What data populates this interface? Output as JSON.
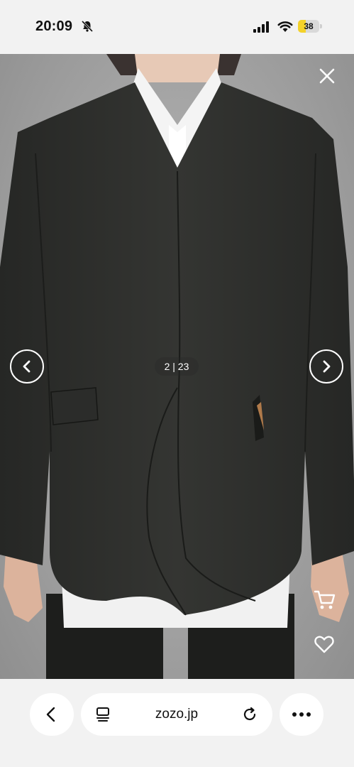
{
  "status_bar": {
    "time": "20:09",
    "battery_level": "38",
    "battery_color": "#f4d22a",
    "icons": [
      "bell-slash-icon",
      "signal-icon",
      "wifi-icon",
      "battery-icon"
    ]
  },
  "viewer": {
    "counter": "2 | 23",
    "close_icon": "close-icon",
    "prev_icon": "chevron-left-icon",
    "next_icon": "chevron-right-icon",
    "cart_icon": "cart-icon",
    "favorite_icon": "heart-icon",
    "image_subject": "black collarless jacket over white shirt"
  },
  "browser_bar": {
    "url": "zozo.jp",
    "back_icon": "chevron-left-icon",
    "tabs_icon": "page-menu-icon",
    "reload_icon": "reload-icon",
    "more_icon": "more-icon"
  }
}
